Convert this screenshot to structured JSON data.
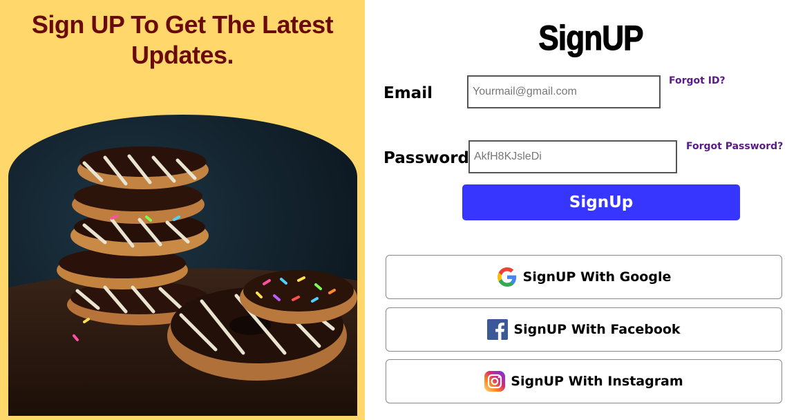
{
  "promo": {
    "title": "Sign UP To Get The Latest Updates.",
    "image_alt": "Stack of chocolate drizzled donuts with sprinkles"
  },
  "form": {
    "title": "SignUP",
    "email_label": "Email",
    "email_placeholder": "Yourmail@gmail.com",
    "email_value": "",
    "password_label": "Password",
    "password_placeholder": "AkfH8KJsleDi",
    "password_value": "",
    "forgot_id": "Forgot ID?",
    "forgot_password": "Forgot Password?",
    "submit_label": "SignUp"
  },
  "social": [
    {
      "label": "SignUP With Google",
      "icon": "google-icon"
    },
    {
      "label": "SignUP With Facebook",
      "icon": "facebook-icon"
    },
    {
      "label": "SignUP With Instagram",
      "icon": "instagram-icon"
    }
  ],
  "colors": {
    "left_background": "#ffd76b",
    "promo_title": "#6b0a0a",
    "submit_button": "#3636ff",
    "forgot_link": "#5a1a8a"
  }
}
